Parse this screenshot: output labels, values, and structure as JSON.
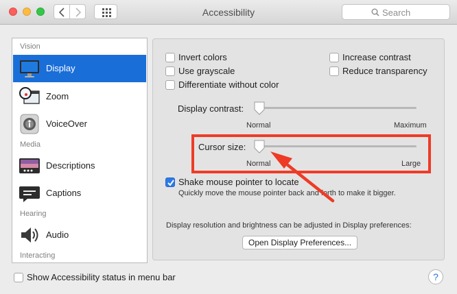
{
  "window": {
    "title": "Accessibility"
  },
  "search": {
    "placeholder": "Search",
    "value": ""
  },
  "sidebar": {
    "sections": [
      "Vision",
      "Media",
      "Hearing",
      "Interacting"
    ],
    "items": [
      {
        "label": "Display",
        "icon": "display-icon",
        "selected": true
      },
      {
        "label": "Zoom",
        "icon": "zoom-icon",
        "selected": false
      },
      {
        "label": "VoiceOver",
        "icon": "voiceover-icon",
        "selected": false
      },
      {
        "label": "Descriptions",
        "icon": "descriptions-icon",
        "selected": false
      },
      {
        "label": "Captions",
        "icon": "captions-icon",
        "selected": false
      },
      {
        "label": "Audio",
        "icon": "audio-icon",
        "selected": false
      }
    ]
  },
  "display": {
    "options_left": [
      {
        "label": "Invert colors",
        "checked": false
      },
      {
        "label": "Use grayscale",
        "checked": false
      },
      {
        "label": "Differentiate without color",
        "checked": false
      }
    ],
    "options_right": [
      {
        "label": "Increase contrast",
        "checked": false
      },
      {
        "label": "Reduce transparency",
        "checked": false
      }
    ],
    "contrast": {
      "label": "Display contrast:",
      "min_label": "Normal",
      "max_label": "Maximum",
      "value": 0
    },
    "cursor": {
      "label": "Cursor size:",
      "min_label": "Normal",
      "max_label": "Large",
      "value": 0
    },
    "shake": {
      "label": "Shake mouse pointer to locate",
      "checked": true,
      "hint": "Quickly move the mouse pointer back and forth to make it bigger."
    },
    "resolution_note": "Display resolution and brightness can be adjusted in Display preferences:",
    "open_button": "Open Display Preferences..."
  },
  "footer": {
    "status_label": "Show Accessibility status in menu bar",
    "status_checked": false,
    "help": "?"
  },
  "colors": {
    "accent": "#1a6ed8",
    "highlight": "#ee3b26",
    "checkbox_checked": "#2c7be5"
  }
}
